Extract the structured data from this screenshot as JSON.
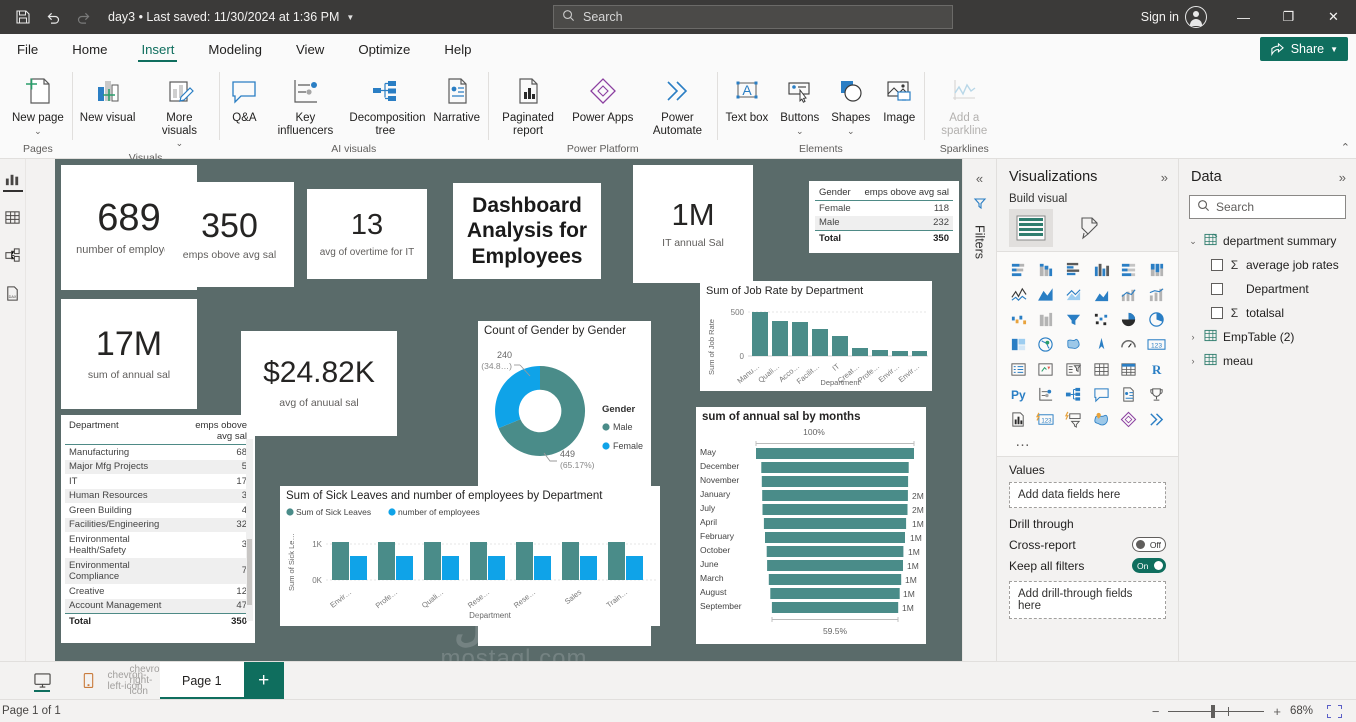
{
  "titlebar": {
    "save_icon": "save-icon",
    "undo_icon": "undo-icon",
    "redo_icon": "redo-icon",
    "doc_title": "day3 • Last saved: 11/30/2024 at 1:36 PM",
    "search_placeholder": "Search",
    "signin": "Sign in",
    "minimize": "—",
    "restore": "❐",
    "close": "✕"
  },
  "menu": {
    "tabs": [
      "File",
      "Home",
      "Insert",
      "Modeling",
      "View",
      "Optimize",
      "Help"
    ],
    "active": "Insert",
    "share_label": "Share"
  },
  "ribbon": {
    "groups": [
      {
        "name": "Pages",
        "items": [
          {
            "label": "New page",
            "icon": "new-page-icon",
            "caret": true,
            "disabled": false
          }
        ]
      },
      {
        "name": "Visuals",
        "items": [
          {
            "label": "New visual",
            "icon": "new-visual-icon",
            "caret": false,
            "disabled": false
          },
          {
            "label": "More visuals",
            "icon": "more-visuals-icon",
            "caret": true,
            "disabled": false
          }
        ]
      },
      {
        "name": "AI visuals",
        "items": [
          {
            "label": "Q&A",
            "icon": "qanda-icon",
            "caret": false,
            "disabled": false
          },
          {
            "label": "Key influencers",
            "icon": "key-influencers-icon",
            "caret": false,
            "disabled": false
          },
          {
            "label": "Decomposition tree",
            "icon": "decomposition-tree-icon",
            "caret": false,
            "disabled": false
          },
          {
            "label": "Narrative",
            "icon": "narrative-icon",
            "caret": false,
            "disabled": false
          }
        ]
      },
      {
        "name": "Power Platform",
        "items": [
          {
            "label": "Paginated report",
            "icon": "paginated-report-icon",
            "caret": false,
            "disabled": false
          },
          {
            "label": "Power Apps",
            "icon": "power-apps-icon",
            "caret": false,
            "disabled": false
          },
          {
            "label": "Power Automate",
            "icon": "power-automate-icon",
            "caret": false,
            "disabled": false
          }
        ]
      },
      {
        "name": "Elements",
        "items": [
          {
            "label": "Text box",
            "icon": "text-box-icon",
            "caret": false,
            "disabled": false
          },
          {
            "label": "Buttons",
            "icon": "buttons-icon",
            "caret": true,
            "disabled": false
          },
          {
            "label": "Shapes",
            "icon": "shapes-icon",
            "caret": true,
            "disabled": false
          },
          {
            "label": "Image",
            "icon": "image-icon",
            "caret": false,
            "disabled": false
          }
        ]
      },
      {
        "name": "Sparklines",
        "items": [
          {
            "label": "Add a sparkline",
            "icon": "sparkline-icon",
            "caret": false,
            "disabled": true
          }
        ]
      }
    ],
    "collapse_icon": "chevron-up-icon"
  },
  "leftrail": {
    "items": [
      {
        "name": "report-view",
        "icon": "report-bar-icon",
        "active": true
      },
      {
        "name": "table-view",
        "icon": "table-grid-icon",
        "active": false
      },
      {
        "name": "model-view",
        "icon": "model-relationship-icon",
        "active": false
      },
      {
        "name": "dax-query-view",
        "icon": "dax-query-icon",
        "active": false
      }
    ]
  },
  "report": {
    "background": "#5a6b6a",
    "watermark": "mostaql.com",
    "cards": {
      "employees": {
        "value": "689",
        "label": "number of employees"
      },
      "above_avg": {
        "value": "350",
        "label": "emps obove avg sal"
      },
      "overtime": {
        "value": "13",
        "label": "avg of overtime for IT"
      },
      "annual_sum": {
        "value": "17M",
        "label": "sum of annual sal"
      },
      "avg_annual": {
        "value": "$24.82K",
        "label": "avg of anuual sal"
      },
      "it_annual": {
        "value": "1M",
        "label": "IT annual Sal"
      }
    },
    "title_card": {
      "text": "Dashboard Analysis for Employees"
    },
    "gender_table": {
      "headers": [
        "Gender",
        "emps obove avg sal"
      ],
      "rows": [
        {
          "label": "Female",
          "value": "118"
        },
        {
          "label": "Male",
          "value": "232"
        }
      ],
      "total": {
        "label": "Total",
        "value": "350"
      }
    },
    "dept_table": {
      "headers": [
        "Department",
        "emps obove avg sal"
      ],
      "rows": [
        {
          "label": "Manufacturing",
          "value": "68"
        },
        {
          "label": "Major Mfg Projects",
          "value": "5"
        },
        {
          "label": "IT",
          "value": "17"
        },
        {
          "label": "Human Resources",
          "value": "3"
        },
        {
          "label": "Green Building",
          "value": "4"
        },
        {
          "label": "Facilities/Engineering",
          "value": "32"
        },
        {
          "label": "Environmental Health/Safety",
          "value": "3"
        },
        {
          "label": "Environmental Compliance",
          "value": "7"
        },
        {
          "label": "Creative",
          "value": "12"
        },
        {
          "label": "Account Management",
          "value": "47"
        }
      ],
      "total": {
        "label": "Total",
        "value": "350"
      }
    }
  },
  "chart_data": [
    {
      "id": "gender-donut",
      "type": "pie",
      "title": "Count of Gender by Gender",
      "legend_title": "Gender",
      "legend_position": "right",
      "slices": [
        {
          "name": "Male",
          "value": 449,
          "pct": "65.17%",
          "label": "449",
          "sublabel": "(65.17%)",
          "color": "#4a8c89"
        },
        {
          "name": "Female",
          "value": 240,
          "pct": "34.8%",
          "label": "240",
          "sublabel": "(34.8…)",
          "color": "#0fa3e8"
        }
      ]
    },
    {
      "id": "job-rate-by-department",
      "type": "bar",
      "title": "Sum of Job Rate by Department",
      "xlabel": "Department",
      "ylabel": "Sum of Job Rate",
      "ylim": [
        0,
        560
      ],
      "yticks": [
        "0",
        "500"
      ],
      "grid": true,
      "color": "#4a8c89",
      "categories": [
        "Manu…",
        "Quali…",
        "Acco…",
        "Facilit…",
        "IT",
        "Creat…",
        "Profe…",
        "Envir…",
        "Envir…"
      ],
      "values": [
        500,
        345,
        330,
        240,
        175,
        80,
        58,
        45,
        42
      ]
    },
    {
      "id": "sick-leaves-by-department",
      "type": "bar",
      "title": "Sum of Sick Leaves and number of employees by Department",
      "xlabel": "Department",
      "ylabel": "Sum of Sick Le…",
      "yticks": [
        "0K",
        "1K"
      ],
      "ylim": [
        0,
        1150
      ],
      "grid": true,
      "legend_position": "top",
      "categories": [
        "Envir…",
        "Profe…",
        "Quali…",
        "Rese…",
        "Rese…",
        "Sales",
        "Train…"
      ],
      "series": [
        {
          "name": "Sum of Sick Leaves",
          "color": "#4a8c89",
          "values": [
            1080,
            1080,
            1080,
            1080,
            1080,
            1080,
            1080
          ]
        },
        {
          "name": "number of employees",
          "color": "#0fa3e8",
          "values": [
            700,
            700,
            700,
            700,
            700,
            700,
            700
          ]
        }
      ]
    },
    {
      "id": "annual-sal-by-months",
      "type": "bar",
      "subtype": "funnel",
      "title": "sum of annual sal by months",
      "top_label": "100%",
      "bottom_label": "59.5%",
      "color": "#4a8c89",
      "categories": [
        "May",
        "December",
        "November",
        "January",
        "July",
        "April",
        "February",
        "October",
        "June",
        "March",
        "August",
        "September"
      ],
      "values": [
        100,
        93.3,
        92.6,
        92.2,
        91.8,
        90.0,
        88.6,
        86.5,
        86.0,
        83.8,
        81.9,
        79.8
      ],
      "data_labels": [
        "",
        "",
        "",
        "2M",
        "2M",
        "1M",
        "1M",
        "1M",
        "1M",
        "1M",
        "1M",
        "1M"
      ]
    }
  ],
  "filters": {
    "collapse_icon": "chevrons-left-icon",
    "filter_icon": "filter-funnel-icon",
    "label": "Filters"
  },
  "visualizations": {
    "title": "Visualizations",
    "expand_icon": "chevrons-right-icon",
    "build_visual": "Build visual",
    "tabs": [
      {
        "name": "build-visual-fields",
        "icon": "fields-grid-icon",
        "selected": true
      },
      {
        "name": "format-visual",
        "icon": "paint-roller-icon",
        "selected": false
      }
    ],
    "gallery": [
      "stacked-bar-chart",
      "stacked-column-chart",
      "clustered-bar-chart",
      "clustered-column-chart",
      "100-stacked-bar-chart",
      "100-stacked-column-chart",
      "line-chart",
      "area-chart",
      "stacked-area-chart",
      "line-stacked-column-chart",
      "line-clustered-column-chart",
      "ribbon-chart",
      "waterfall-chart",
      "funnel-chart",
      "scatter-chart",
      "pie-chart",
      "donut-chart",
      "treemap",
      "map",
      "filled-map",
      "azure-map",
      "shape-map",
      "card",
      "multi-row-card",
      "kpi",
      "slicer",
      "table",
      "matrix",
      "r-script-visual",
      "python-visual",
      "key-influencers",
      "decomposition-tree",
      "qanda",
      "narrative",
      "metrics",
      "paginated-report",
      "power-apps",
      "power-automate",
      "arcgis-map",
      "smart-narrative",
      "more-visuals"
    ],
    "more_options": "…",
    "values_label": "Values",
    "values_placeholder": "Add data fields here",
    "drill_through_label": "Drill through",
    "cross_report_label": "Cross-report",
    "cross_report_state": "Off",
    "keep_filters_label": "Keep all filters",
    "keep_filters_state": "On",
    "drill_placeholder": "Add drill-through fields here"
  },
  "datapane": {
    "title": "Data",
    "expand_icon": "chevrons-right-icon",
    "search_placeholder": "Search",
    "tables": [
      {
        "name": "department summary",
        "expanded": true,
        "icon": "calculated-table-icon",
        "fields": [
          {
            "name": "average job rates",
            "measure": true
          },
          {
            "name": "Department",
            "measure": false
          },
          {
            "name": "totalsal",
            "measure": true
          }
        ]
      },
      {
        "name": "EmpTable (2)",
        "expanded": false,
        "icon": "table-icon",
        "fields": []
      },
      {
        "name": "meau",
        "expanded": false,
        "icon": "table-icon",
        "fields": []
      }
    ]
  },
  "pagebar": {
    "desktop_icon": "desktop-view-icon",
    "mobile_icon": "mobile-view-icon",
    "prev_icon": "chevron-left-icon",
    "next_icon": "chevron-right-icon",
    "tabs": [
      {
        "label": "Page 1",
        "active": true
      }
    ],
    "add_label": "+"
  },
  "statusbar": {
    "page_info": "Page 1 of 1",
    "zoom_out": "−",
    "zoom_in": "+",
    "zoom_level": "68%",
    "fit_icon": "fit-to-page-icon"
  }
}
